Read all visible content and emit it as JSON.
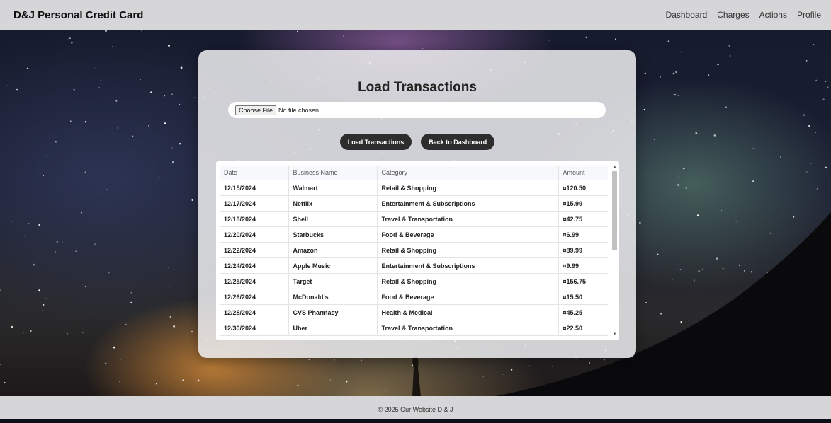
{
  "navbar": {
    "brand": "D&J Personal Credit Card",
    "links": [
      "Dashboard",
      "Charges",
      "Actions",
      "Profile"
    ]
  },
  "card": {
    "title": "Load Transactions",
    "file_input": {
      "button_label": "Choose File",
      "status": "No file chosen"
    },
    "buttons": {
      "load": "Load Transactions",
      "back": "Back to Dashboard"
    }
  },
  "table": {
    "headers": [
      "Date",
      "Business Name",
      "Category",
      "Amount"
    ],
    "rows": [
      [
        "12/15/2024",
        "Walmart",
        "Retail & Shopping",
        "¤120.50"
      ],
      [
        "12/17/2024",
        "Netflix",
        "Entertainment & Subscriptions",
        "¤15.99"
      ],
      [
        "12/18/2024",
        "Shell",
        "Travel & Transportation",
        "¤42.75"
      ],
      [
        "12/20/2024",
        "Starbucks",
        "Food & Beverage",
        "¤6.99"
      ],
      [
        "12/22/2024",
        "Amazon",
        "Retail & Shopping",
        "¤89.99"
      ],
      [
        "12/24/2024",
        "Apple Music",
        "Entertainment & Subscriptions",
        "¤9.99"
      ],
      [
        "12/25/2024",
        "Target",
        "Retail & Shopping",
        "¤156.75"
      ],
      [
        "12/26/2024",
        "McDonald's",
        "Food & Beverage",
        "¤15.50"
      ],
      [
        "12/28/2024",
        "CVS Pharmacy",
        "Health & Medical",
        "¤45.25"
      ],
      [
        "12/30/2024",
        "Uber",
        "Travel & Transportation",
        "¤22.50"
      ]
    ]
  },
  "footer": {
    "text": "© 2025 Our Website D & J"
  }
}
